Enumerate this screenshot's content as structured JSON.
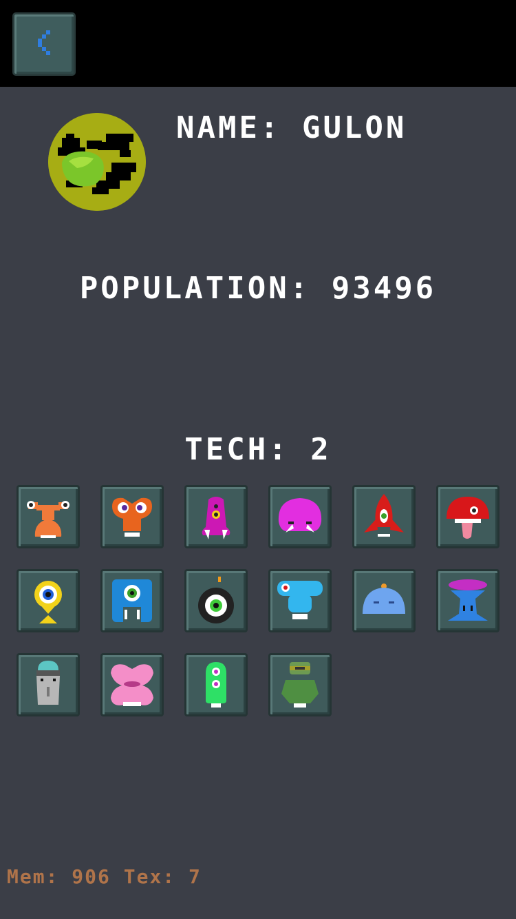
{
  "header": {
    "back_icon": "chevron-left-icon",
    "back_color": "#2f7de0"
  },
  "planet": {
    "name_label": "NAME:",
    "name": "GULON",
    "population_label": "POPULATION:",
    "population": "93496",
    "tech_label": "TECH:",
    "tech": "2",
    "colors": {
      "surface": "#a7ad14",
      "land": "#000000",
      "core": "#7bc62a"
    }
  },
  "aliens": [
    {
      "icon": "orange-stalk-eyed-alien-icon",
      "color": "#f07a3a"
    },
    {
      "icon": "orange-purple-eyed-alien-icon",
      "color": "#e8641e"
    },
    {
      "icon": "magenta-three-eyed-fanged-alien-icon",
      "color": "#cc18b4"
    },
    {
      "icon": "pink-blob-fanged-alien-icon",
      "color": "#e22ee0"
    },
    {
      "icon": "red-rocket-alien-icon",
      "color": "#d81d1a"
    },
    {
      "icon": "red-mushroom-tongue-alien-icon",
      "color": "#d8171a"
    },
    {
      "icon": "yellow-eyeball-fish-alien-icon",
      "color": "#f2d21a"
    },
    {
      "icon": "blue-square-cyclops-alien-icon",
      "color": "#1f88d8"
    },
    {
      "icon": "black-bomb-cyclops-alien-icon",
      "color": "#222222"
    },
    {
      "icon": "cyan-hammerhead-alien-icon",
      "color": "#33b6ee"
    },
    {
      "icon": "light-blue-sleepy-blob-alien-icon",
      "color": "#6ea5ef"
    },
    {
      "icon": "blue-brain-mushroom-alien-icon",
      "color": "#2f82e2"
    },
    {
      "icon": "grey-dome-robot-alien-icon",
      "color": "#b7b7b7"
    },
    {
      "icon": "pink-lips-alien-icon",
      "color": "#f48ec8"
    },
    {
      "icon": "green-two-eyed-slug-alien-icon",
      "color": "#2ee066"
    },
    {
      "icon": "olive-goggle-alien-icon",
      "color": "#6d9a52"
    }
  ],
  "footer": {
    "mem_label": "Mem:",
    "mem_value": "906",
    "tex_label": "Tex:",
    "tex_value": "7"
  }
}
